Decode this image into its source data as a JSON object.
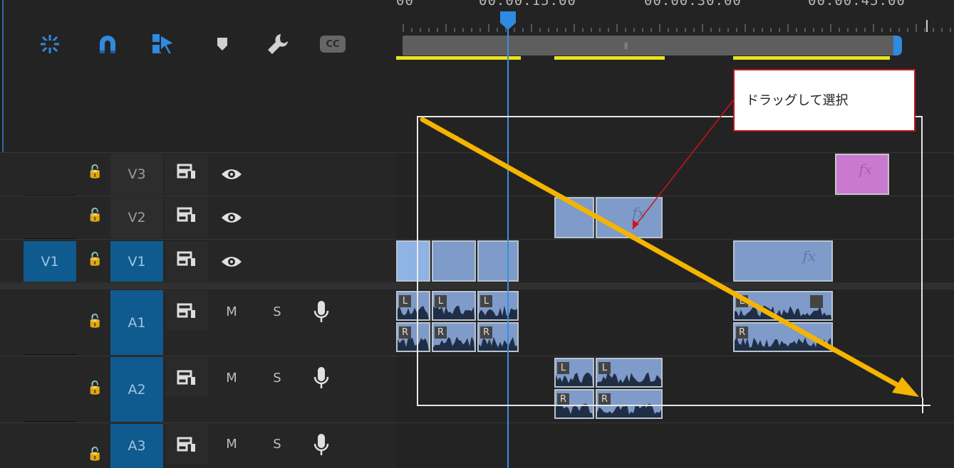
{
  "ruler": {
    "timecodes": [
      "00",
      "00:00:15:00",
      "00:00:30:00",
      "00:00:45:00"
    ]
  },
  "toolbar": {
    "tools": [
      {
        "name": "nest-sequence",
        "icon": "nest-icon",
        "color": "#2f8ae0"
      },
      {
        "name": "snap",
        "icon": "magnet-icon",
        "color": "#2f8ae0"
      },
      {
        "name": "linked-selection",
        "icon": "linked-selection-icon",
        "color": "#2f8ae0"
      },
      {
        "name": "add-marker",
        "icon": "marker-icon",
        "color": "#d0d0d0"
      },
      {
        "name": "timeline-settings",
        "icon": "wrench-icon",
        "color": "#d0d0d0"
      },
      {
        "name": "captions",
        "icon": "cc-icon",
        "label": "CC",
        "color": "#666666"
      }
    ]
  },
  "tracks": {
    "video": [
      {
        "name": "V3",
        "targeted": false,
        "source": ""
      },
      {
        "name": "V2",
        "targeted": false,
        "source": ""
      },
      {
        "name": "V1",
        "targeted": true,
        "source": "V1"
      }
    ],
    "audio": [
      {
        "name": "A1",
        "targeted": true,
        "mute": "M",
        "solo": "S"
      },
      {
        "name": "A2",
        "targeted": true,
        "mute": "M",
        "solo": "S"
      },
      {
        "name": "A3",
        "targeted": true,
        "mute": "M",
        "solo": "S"
      }
    ]
  },
  "clips": {
    "fx_label": "fx",
    "audio_channels": [
      "L",
      "R"
    ]
  },
  "annotation": {
    "callout_text": "ドラッグして選択",
    "arrow_color": "#f5b400",
    "callout_border_color": "#c0151c"
  },
  "colors": {
    "accent": "#2f8ae0",
    "target_track": "#0f5a8e",
    "video_clip": "#7e9bc9",
    "fx_clip": "#c97ad0",
    "work_area": "#e8e31e"
  }
}
